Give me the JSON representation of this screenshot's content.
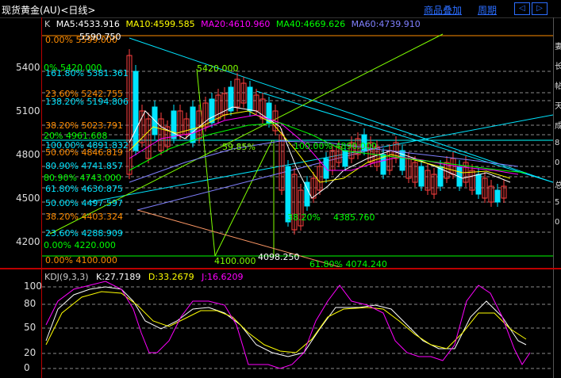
{
  "header": {
    "title": "现货黄金(AU)<日线>",
    "overlay_button": "商品叠加",
    "period_button": "周期",
    "nav_left": "◁",
    "nav_right": "▷"
  },
  "indicators": {
    "k_label": "K",
    "ma5": "MA5:4533.916",
    "ma10": "MA10:4599.585",
    "ma20": "MA20:4610.960",
    "ma40": "MA40:4669.626",
    "ma60": "MA60:4739.910",
    "colors": {
      "ma5": "#ffffff",
      "ma10": "#ffff00",
      "ma20": "#ff00ff",
      "ma40": "#00ff00",
      "ma60": "#8080ff"
    }
  },
  "price_axis": [
    "5400",
    "5100",
    "4800",
    "4500",
    "4200"
  ],
  "high_label": "5590.750",
  "low_label": "4098.250",
  "fib_labels": {
    "f0": "0.00%  5599.000",
    "f1618": "161.80%  5381.361",
    "f236": "23.60%  5242.755",
    "f1382": "138.20%  5194.806",
    "f382": "38.20%  5023.791",
    "f20": "20%   4961.608",
    "f100": "100.00%  4891.832",
    "f50": "50.00%  4846.819",
    "f809": "80.90%  4741.857",
    "f618": "61.80%  4630.875",
    "f5": "50.00%  4497.597",
    "f382b": "38.20%  4403.324",
    "f236b": "23.60%  4288.909",
    "f00b": "0.00%   4220.000",
    "f000": "0.00%  4100.000",
    "f100pct": "100.00%  4100.000",
    "f0pct": "0%   5420.000",
    "f6185": "61.80%  4074.240",
    "f5420": "5420.000",
    "f4100": "4100.000",
    "f5985": "59.85%",
    "f1000": "100.00%   4890.000",
    "f3820": "38.20%",
    "f4385": "4385.760",
    "f8090": "80.90%  4743.000"
  },
  "kdj": {
    "name": "KDJ(9,3,3)",
    "k": "K:27.7189",
    "d": "D:33.2679",
    "j": "J:16.6209",
    "colors": {
      "k": "#ffffff",
      "d": "#ffff00",
      "j": "#ff00ff"
    },
    "axis": [
      "100",
      "80",
      "50",
      "20",
      "0"
    ]
  },
  "side_labels": [
    "妻",
    "长",
    "帖",
    "天",
    "成",
    "8",
    "0",
    "总",
    "5",
    "0"
  ]
}
